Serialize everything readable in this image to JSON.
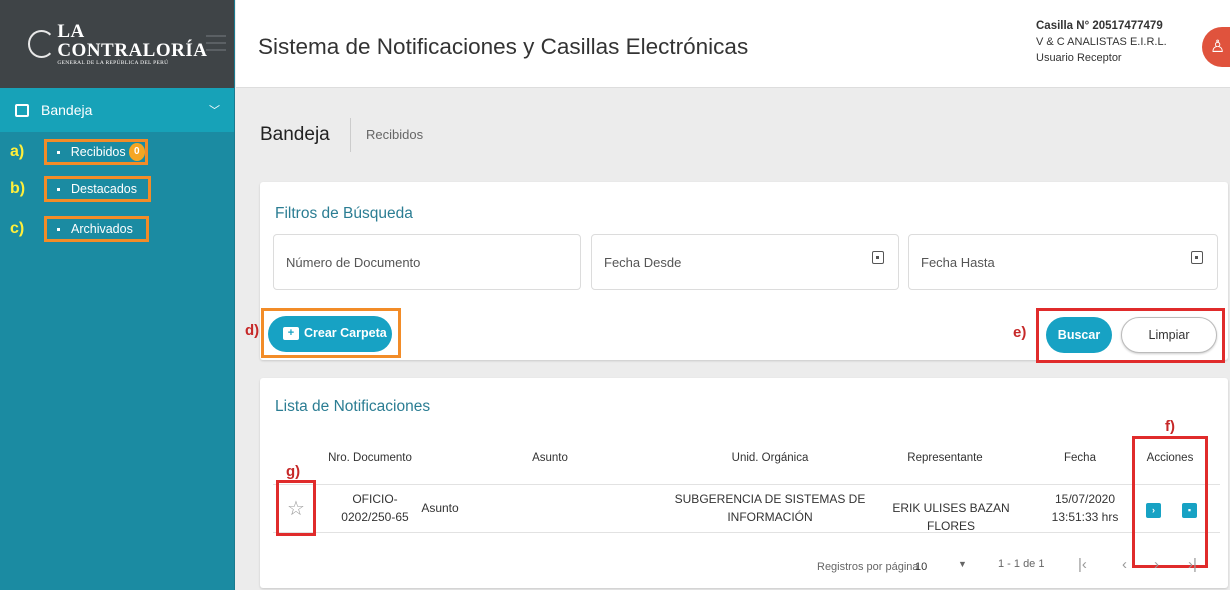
{
  "brand": {
    "name": "LA CONTRALORÍA",
    "sub": "GENERAL DE LA REPÚBLICA DEL PERÚ"
  },
  "sidebar": {
    "section": "Bandeja",
    "items": [
      {
        "marker": "a)",
        "label": "Recibidos",
        "badge": "0"
      },
      {
        "marker": "b)",
        "label": "Destacados"
      },
      {
        "marker": "c)",
        "label": "Archivados"
      }
    ]
  },
  "header": {
    "title": "Sistema de Notificaciones y Casillas Electrónicas",
    "casilla": "Casilla N° 20517477479",
    "company": "V & C ANALISTAS E.I.R.L.",
    "role": "Usuario Receptor"
  },
  "page": {
    "title": "Bandeja",
    "crumb": "Recibidos"
  },
  "filters": {
    "title": "Filtros de Búsqueda",
    "doc_placeholder": "Número de Documento",
    "from_placeholder": "Fecha Desde",
    "to_placeholder": "Fecha Hasta",
    "create_folder": "Crear Carpeta",
    "search": "Buscar",
    "clear": "Limpiar"
  },
  "annotations": {
    "d": "d)",
    "e": "e)",
    "f": "f)",
    "g": "g)"
  },
  "list": {
    "title": "Lista de Notificaciones",
    "columns": [
      "Nro. Documento",
      "Asunto",
      "Unid. Orgánica",
      "Representante",
      "Fecha",
      "Acciones"
    ],
    "rows": [
      {
        "doc_line1": "OFICIO-",
        "doc_line2": "0202/250-65",
        "subject": "Asunto",
        "unit_line1": "SUBGERENCIA DE SISTEMAS DE",
        "unit_line2": "INFORMACIÓN",
        "rep": "ERIK ULISES BAZAN FLORES",
        "date": "15/07/2020",
        "time": "13:51:33 hrs"
      }
    ],
    "per_page_label": "Registros por página",
    "per_page_value": "10",
    "range": "1 - 1 de 1"
  }
}
